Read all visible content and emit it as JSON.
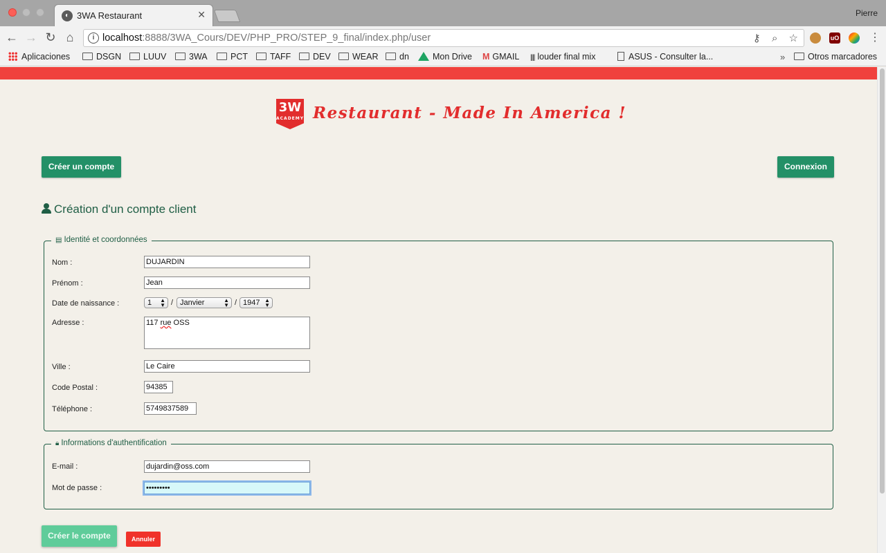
{
  "browser": {
    "tab_title": "3WA Restaurant",
    "tab_close": "✕",
    "profile_name": "Pierre",
    "url_host": "localhost",
    "url_path": ":8888/3WA_Cours/DEV/PHP_PRO/STEP_9_final/index.php/user",
    "bookmarks": [
      "Aplicaciones",
      "DSGN",
      "LUUV",
      "3WA",
      "PCT",
      "TAFF",
      "DEV",
      "WEAR",
      "dn",
      "Mon Drive",
      "GMAIL",
      "louder final mix",
      "ASUS - Consulter la...",
      "Otros marcadores"
    ],
    "bookmark_overflow": "»"
  },
  "site": {
    "logo_text": "3W",
    "logo_subtext": "ACADEMY",
    "title": "Restaurant - Made In America !",
    "brand_red": "#e22d2d",
    "brand_green": "#239067"
  },
  "nav": {
    "create_account": "Créer un compte",
    "login": "Connexion"
  },
  "form": {
    "heading": "Création d'un compte client",
    "identity_legend": "Identité et coordonnées",
    "auth_legend": "Informations d'authentification",
    "labels": {
      "last_name": "Nom :",
      "first_name": "Prénom :",
      "birth_date": "Date de naissance :",
      "address": "Adresse :",
      "city": "Ville :",
      "postal_code": "Code Postal :",
      "phone": "Téléphone :",
      "email": "E-mail :",
      "password": "Mot de passe :"
    },
    "values": {
      "last_name": "DUJARDIN",
      "first_name": "Jean",
      "birth_day": "1",
      "birth_month": "Janvier",
      "birth_year": "1947",
      "address_pre": "117 ",
      "address_spell": "rue",
      "address_post": " OSS",
      "city": "Le Caire",
      "postal_code": "94385",
      "phone": "5749837589",
      "email": "dujardin@oss.com",
      "password_masked": "•••••••••"
    },
    "date_separator": "/",
    "submit": "Créer le compte",
    "cancel": "Annuler"
  }
}
